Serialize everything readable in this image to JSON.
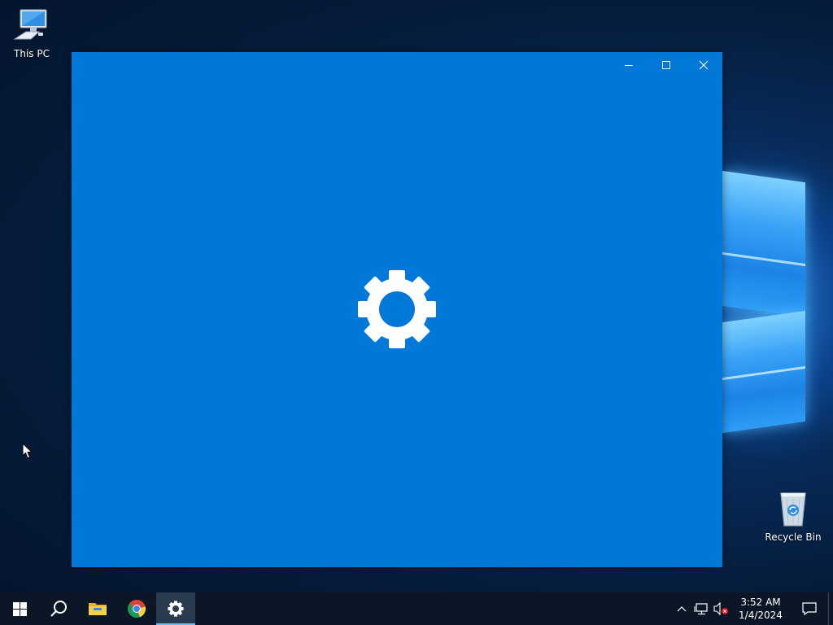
{
  "desktop": {
    "icons": [
      {
        "label": "This PC",
        "icon": "computer-icon"
      },
      {
        "label": "Recycle Bin",
        "icon": "recycle-bin-icon"
      }
    ]
  },
  "window": {
    "app": "Settings",
    "state": "splash-screen",
    "accent": "#0078d7",
    "controls": [
      {
        "label": "Minimize",
        "icon": "minimize-icon"
      },
      {
        "label": "Maximize",
        "icon": "maximize-icon"
      },
      {
        "label": "Close",
        "icon": "close-icon"
      }
    ],
    "splash_icon": "gear-icon"
  },
  "taskbar": {
    "items": [
      {
        "label": "Start",
        "icon": "windows-logo-icon"
      },
      {
        "label": "Search",
        "icon": "search-icon"
      },
      {
        "label": "File Explorer",
        "icon": "folder-icon"
      },
      {
        "label": "Google Chrome",
        "icon": "chrome-icon"
      },
      {
        "label": "Settings",
        "icon": "gear-icon",
        "active": true
      }
    ],
    "tray": {
      "icons": [
        "chevron-up-icon",
        "network-icon",
        "volume-muted-icon"
      ],
      "time": "3:52 AM",
      "date": "1/4/2024",
      "notifications_icon": "notification-icon"
    }
  }
}
